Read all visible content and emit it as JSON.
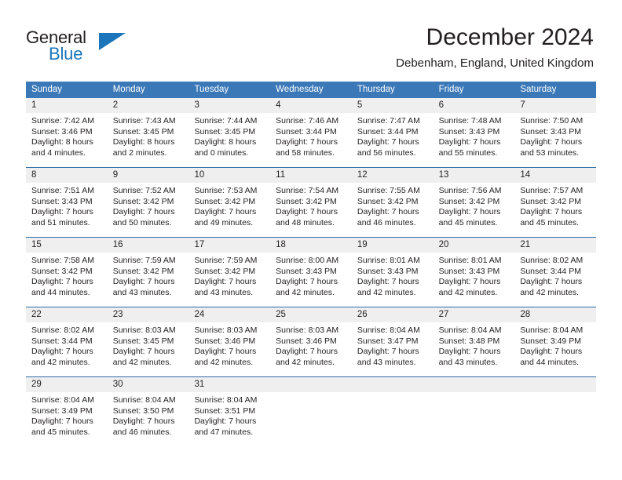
{
  "brand": {
    "name_top": "General",
    "name_bottom": "Blue",
    "accent_color": "#1a75bb"
  },
  "header": {
    "title": "December 2024",
    "subtitle": "Debenham, England, United Kingdom"
  },
  "theme": {
    "header_blue": "#3b78b7",
    "row_divider_blue": "#2b6ca3",
    "daynum_band": "#efeff0",
    "text": "#231f20"
  },
  "weekdays": [
    "Sunday",
    "Monday",
    "Tuesday",
    "Wednesday",
    "Thursday",
    "Friday",
    "Saturday"
  ],
  "weeks": [
    {
      "days": [
        {
          "num": "1",
          "lines": [
            "Sunrise: 7:42 AM",
            "Sunset: 3:46 PM",
            "Daylight: 8 hours",
            "and 4 minutes."
          ]
        },
        {
          "num": "2",
          "lines": [
            "Sunrise: 7:43 AM",
            "Sunset: 3:45 PM",
            "Daylight: 8 hours",
            "and 2 minutes."
          ]
        },
        {
          "num": "3",
          "lines": [
            "Sunrise: 7:44 AM",
            "Sunset: 3:45 PM",
            "Daylight: 8 hours",
            "and 0 minutes."
          ]
        },
        {
          "num": "4",
          "lines": [
            "Sunrise: 7:46 AM",
            "Sunset: 3:44 PM",
            "Daylight: 7 hours",
            "and 58 minutes."
          ]
        },
        {
          "num": "5",
          "lines": [
            "Sunrise: 7:47 AM",
            "Sunset: 3:44 PM",
            "Daylight: 7 hours",
            "and 56 minutes."
          ]
        },
        {
          "num": "6",
          "lines": [
            "Sunrise: 7:48 AM",
            "Sunset: 3:43 PM",
            "Daylight: 7 hours",
            "and 55 minutes."
          ]
        },
        {
          "num": "7",
          "lines": [
            "Sunrise: 7:50 AM",
            "Sunset: 3:43 PM",
            "Daylight: 7 hours",
            "and 53 minutes."
          ]
        }
      ]
    },
    {
      "days": [
        {
          "num": "8",
          "lines": [
            "Sunrise: 7:51 AM",
            "Sunset: 3:43 PM",
            "Daylight: 7 hours",
            "and 51 minutes."
          ]
        },
        {
          "num": "9",
          "lines": [
            "Sunrise: 7:52 AM",
            "Sunset: 3:42 PM",
            "Daylight: 7 hours",
            "and 50 minutes."
          ]
        },
        {
          "num": "10",
          "lines": [
            "Sunrise: 7:53 AM",
            "Sunset: 3:42 PM",
            "Daylight: 7 hours",
            "and 49 minutes."
          ]
        },
        {
          "num": "11",
          "lines": [
            "Sunrise: 7:54 AM",
            "Sunset: 3:42 PM",
            "Daylight: 7 hours",
            "and 48 minutes."
          ]
        },
        {
          "num": "12",
          "lines": [
            "Sunrise: 7:55 AM",
            "Sunset: 3:42 PM",
            "Daylight: 7 hours",
            "and 46 minutes."
          ]
        },
        {
          "num": "13",
          "lines": [
            "Sunrise: 7:56 AM",
            "Sunset: 3:42 PM",
            "Daylight: 7 hours",
            "and 45 minutes."
          ]
        },
        {
          "num": "14",
          "lines": [
            "Sunrise: 7:57 AM",
            "Sunset: 3:42 PM",
            "Daylight: 7 hours",
            "and 45 minutes."
          ]
        }
      ]
    },
    {
      "days": [
        {
          "num": "15",
          "lines": [
            "Sunrise: 7:58 AM",
            "Sunset: 3:42 PM",
            "Daylight: 7 hours",
            "and 44 minutes."
          ]
        },
        {
          "num": "16",
          "lines": [
            "Sunrise: 7:59 AM",
            "Sunset: 3:42 PM",
            "Daylight: 7 hours",
            "and 43 minutes."
          ]
        },
        {
          "num": "17",
          "lines": [
            "Sunrise: 7:59 AM",
            "Sunset: 3:42 PM",
            "Daylight: 7 hours",
            "and 43 minutes."
          ]
        },
        {
          "num": "18",
          "lines": [
            "Sunrise: 8:00 AM",
            "Sunset: 3:43 PM",
            "Daylight: 7 hours",
            "and 42 minutes."
          ]
        },
        {
          "num": "19",
          "lines": [
            "Sunrise: 8:01 AM",
            "Sunset: 3:43 PM",
            "Daylight: 7 hours",
            "and 42 minutes."
          ]
        },
        {
          "num": "20",
          "lines": [
            "Sunrise: 8:01 AM",
            "Sunset: 3:43 PM",
            "Daylight: 7 hours",
            "and 42 minutes."
          ]
        },
        {
          "num": "21",
          "lines": [
            "Sunrise: 8:02 AM",
            "Sunset: 3:44 PM",
            "Daylight: 7 hours",
            "and 42 minutes."
          ]
        }
      ]
    },
    {
      "days": [
        {
          "num": "22",
          "lines": [
            "Sunrise: 8:02 AM",
            "Sunset: 3:44 PM",
            "Daylight: 7 hours",
            "and 42 minutes."
          ]
        },
        {
          "num": "23",
          "lines": [
            "Sunrise: 8:03 AM",
            "Sunset: 3:45 PM",
            "Daylight: 7 hours",
            "and 42 minutes."
          ]
        },
        {
          "num": "24",
          "lines": [
            "Sunrise: 8:03 AM",
            "Sunset: 3:46 PM",
            "Daylight: 7 hours",
            "and 42 minutes."
          ]
        },
        {
          "num": "25",
          "lines": [
            "Sunrise: 8:03 AM",
            "Sunset: 3:46 PM",
            "Daylight: 7 hours",
            "and 42 minutes."
          ]
        },
        {
          "num": "26",
          "lines": [
            "Sunrise: 8:04 AM",
            "Sunset: 3:47 PM",
            "Daylight: 7 hours",
            "and 43 minutes."
          ]
        },
        {
          "num": "27",
          "lines": [
            "Sunrise: 8:04 AM",
            "Sunset: 3:48 PM",
            "Daylight: 7 hours",
            "and 43 minutes."
          ]
        },
        {
          "num": "28",
          "lines": [
            "Sunrise: 8:04 AM",
            "Sunset: 3:49 PM",
            "Daylight: 7 hours",
            "and 44 minutes."
          ]
        }
      ]
    },
    {
      "days": [
        {
          "num": "29",
          "lines": [
            "Sunrise: 8:04 AM",
            "Sunset: 3:49 PM",
            "Daylight: 7 hours",
            "and 45 minutes."
          ]
        },
        {
          "num": "30",
          "lines": [
            "Sunrise: 8:04 AM",
            "Sunset: 3:50 PM",
            "Daylight: 7 hours",
            "and 46 minutes."
          ]
        },
        {
          "num": "31",
          "lines": [
            "Sunrise: 8:04 AM",
            "Sunset: 3:51 PM",
            "Daylight: 7 hours",
            "and 47 minutes."
          ]
        },
        {
          "num": "",
          "lines": []
        },
        {
          "num": "",
          "lines": []
        },
        {
          "num": "",
          "lines": []
        },
        {
          "num": "",
          "lines": []
        }
      ]
    }
  ]
}
